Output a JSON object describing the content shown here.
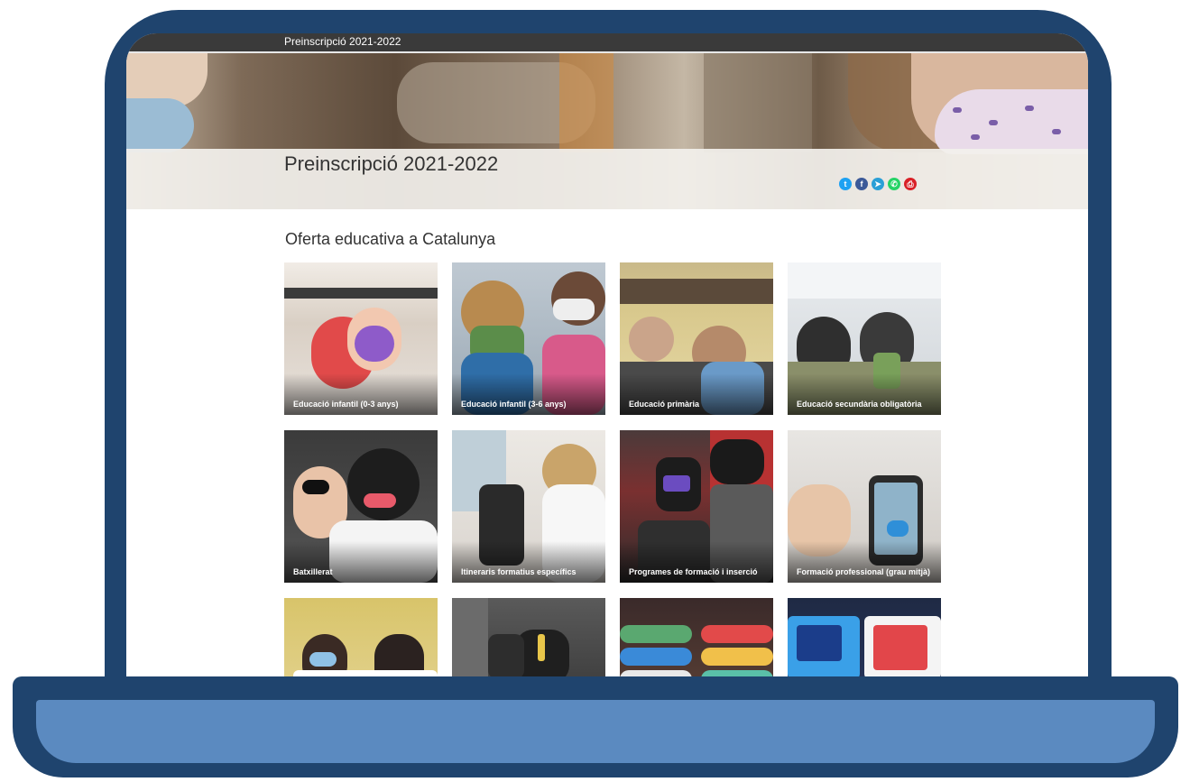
{
  "topbar": {
    "title": "Preinscripció 2021-2022"
  },
  "header": {
    "title": "Preinscripció 2021-2022"
  },
  "share": [
    {
      "icon": "twitter-icon",
      "glyph": "t",
      "color": "#1da1f2"
    },
    {
      "icon": "facebook-icon",
      "glyph": "f",
      "color": "#3b5998"
    },
    {
      "icon": "telegram-icon",
      "glyph": "➤",
      "color": "#2a9fd6"
    },
    {
      "icon": "whatsapp-icon",
      "glyph": "✆",
      "color": "#25d366"
    },
    {
      "icon": "print-icon",
      "glyph": "⎙",
      "color": "#d92027"
    }
  ],
  "main": {
    "section_title": "Oferta educativa a Catalunya",
    "cards": [
      {
        "label": "Educació infantil (0-3 anys)"
      },
      {
        "label": "Educació infantil (3-6 anys)"
      },
      {
        "label": "Educació primària"
      },
      {
        "label": "Educació secundària obligatòria"
      },
      {
        "label": "Batxillerat"
      },
      {
        "label": "Itineraris formatius específics"
      },
      {
        "label": "Programes de formació i inserció"
      },
      {
        "label": "Formació professional (grau mitjà)"
      },
      {
        "label": ""
      },
      {
        "label": ""
      },
      {
        "label": ""
      },
      {
        "label": ""
      }
    ]
  },
  "colors": {
    "laptop_frame": "#1f446e",
    "laptop_base": "#5b8ac0",
    "topbar": "#3a3a3a"
  }
}
